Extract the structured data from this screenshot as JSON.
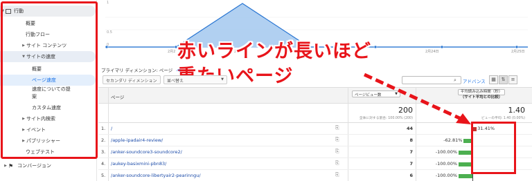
{
  "sidebar": {
    "section": "行動",
    "items": [
      {
        "label": "概要"
      },
      {
        "label": "行動フロー"
      },
      {
        "label": "サイト コンテンツ"
      },
      {
        "label": "サイトの速度"
      },
      {
        "label": "概要"
      },
      {
        "label": "ページ速度"
      },
      {
        "label": "速度についての提"
      },
      {
        "label": "案"
      },
      {
        "label": "カスタム速度"
      },
      {
        "label": "サイト内検索"
      },
      {
        "label": "イベント"
      },
      {
        "label": "パブリッシャー"
      },
      {
        "label": "ウェブテスト"
      }
    ],
    "conversion": "コンバージョン"
  },
  "chart": {
    "y_ticks": [
      "1",
      "0.5",
      "0"
    ],
    "x_labels": [
      "2月2",
      "2月2",
      "2月24日",
      "2月25日"
    ]
  },
  "annotation": {
    "line1": "赤いラインが長いほど",
    "line2": "重たいページ"
  },
  "toolbar": {
    "primary_dimension": "プライマリ ディメンション: ページ",
    "primary_more": "ペ",
    "secondary_dimension": "セカンダリ ディメンション",
    "sort_type": "並べ替え",
    "advanced": "アドバンス",
    "search_icon": "search-icon"
  },
  "table": {
    "header_page": "ページ",
    "header_metric1": "ページビュー数",
    "header_metric2_line1": "平均読み込み時間（秒）",
    "header_metric2_line2": "（サイト平均との比較）",
    "summary_value1": "200",
    "summary_sub1": "全体に対する割合: 100.00% (200)",
    "summary_value2": "1.40",
    "summary_sub2": "ビューの平均: 1.40 (0.00%)",
    "rows": [
      {
        "num": "1.",
        "page": "/",
        "views": "44",
        "pct": "31.41%",
        "positive": true,
        "ratio": 0.3141
      },
      {
        "num": "2.",
        "page": "/apple-ipadair4-review/",
        "views": "8",
        "pct": "-62.81%",
        "positive": false,
        "ratio": 0.6281
      },
      {
        "num": "3.",
        "page": "/anker-soundcore3-soundcore2/",
        "views": "7",
        "pct": "-100.00%",
        "positive": false,
        "ratio": 1.0
      },
      {
        "num": "4.",
        "page": "/aukey-basixmini-pbn83/",
        "views": "7",
        "pct": "-100.00%",
        "positive": false,
        "ratio": 1.0
      },
      {
        "num": "5.",
        "page": "/anker-soundcore-libertyair2-pearinngu/",
        "views": "6",
        "pct": "-100.00%",
        "positive": false,
        "ratio": 1.0
      }
    ]
  },
  "colors": {
    "annotation_red": "#e8141a",
    "positive_bar": "#c5332f",
    "negative_bar": "#4caf50",
    "link": "#1a4aa8",
    "chart_line": "#2a76d2",
    "chart_fill": "#a8cbef"
  }
}
